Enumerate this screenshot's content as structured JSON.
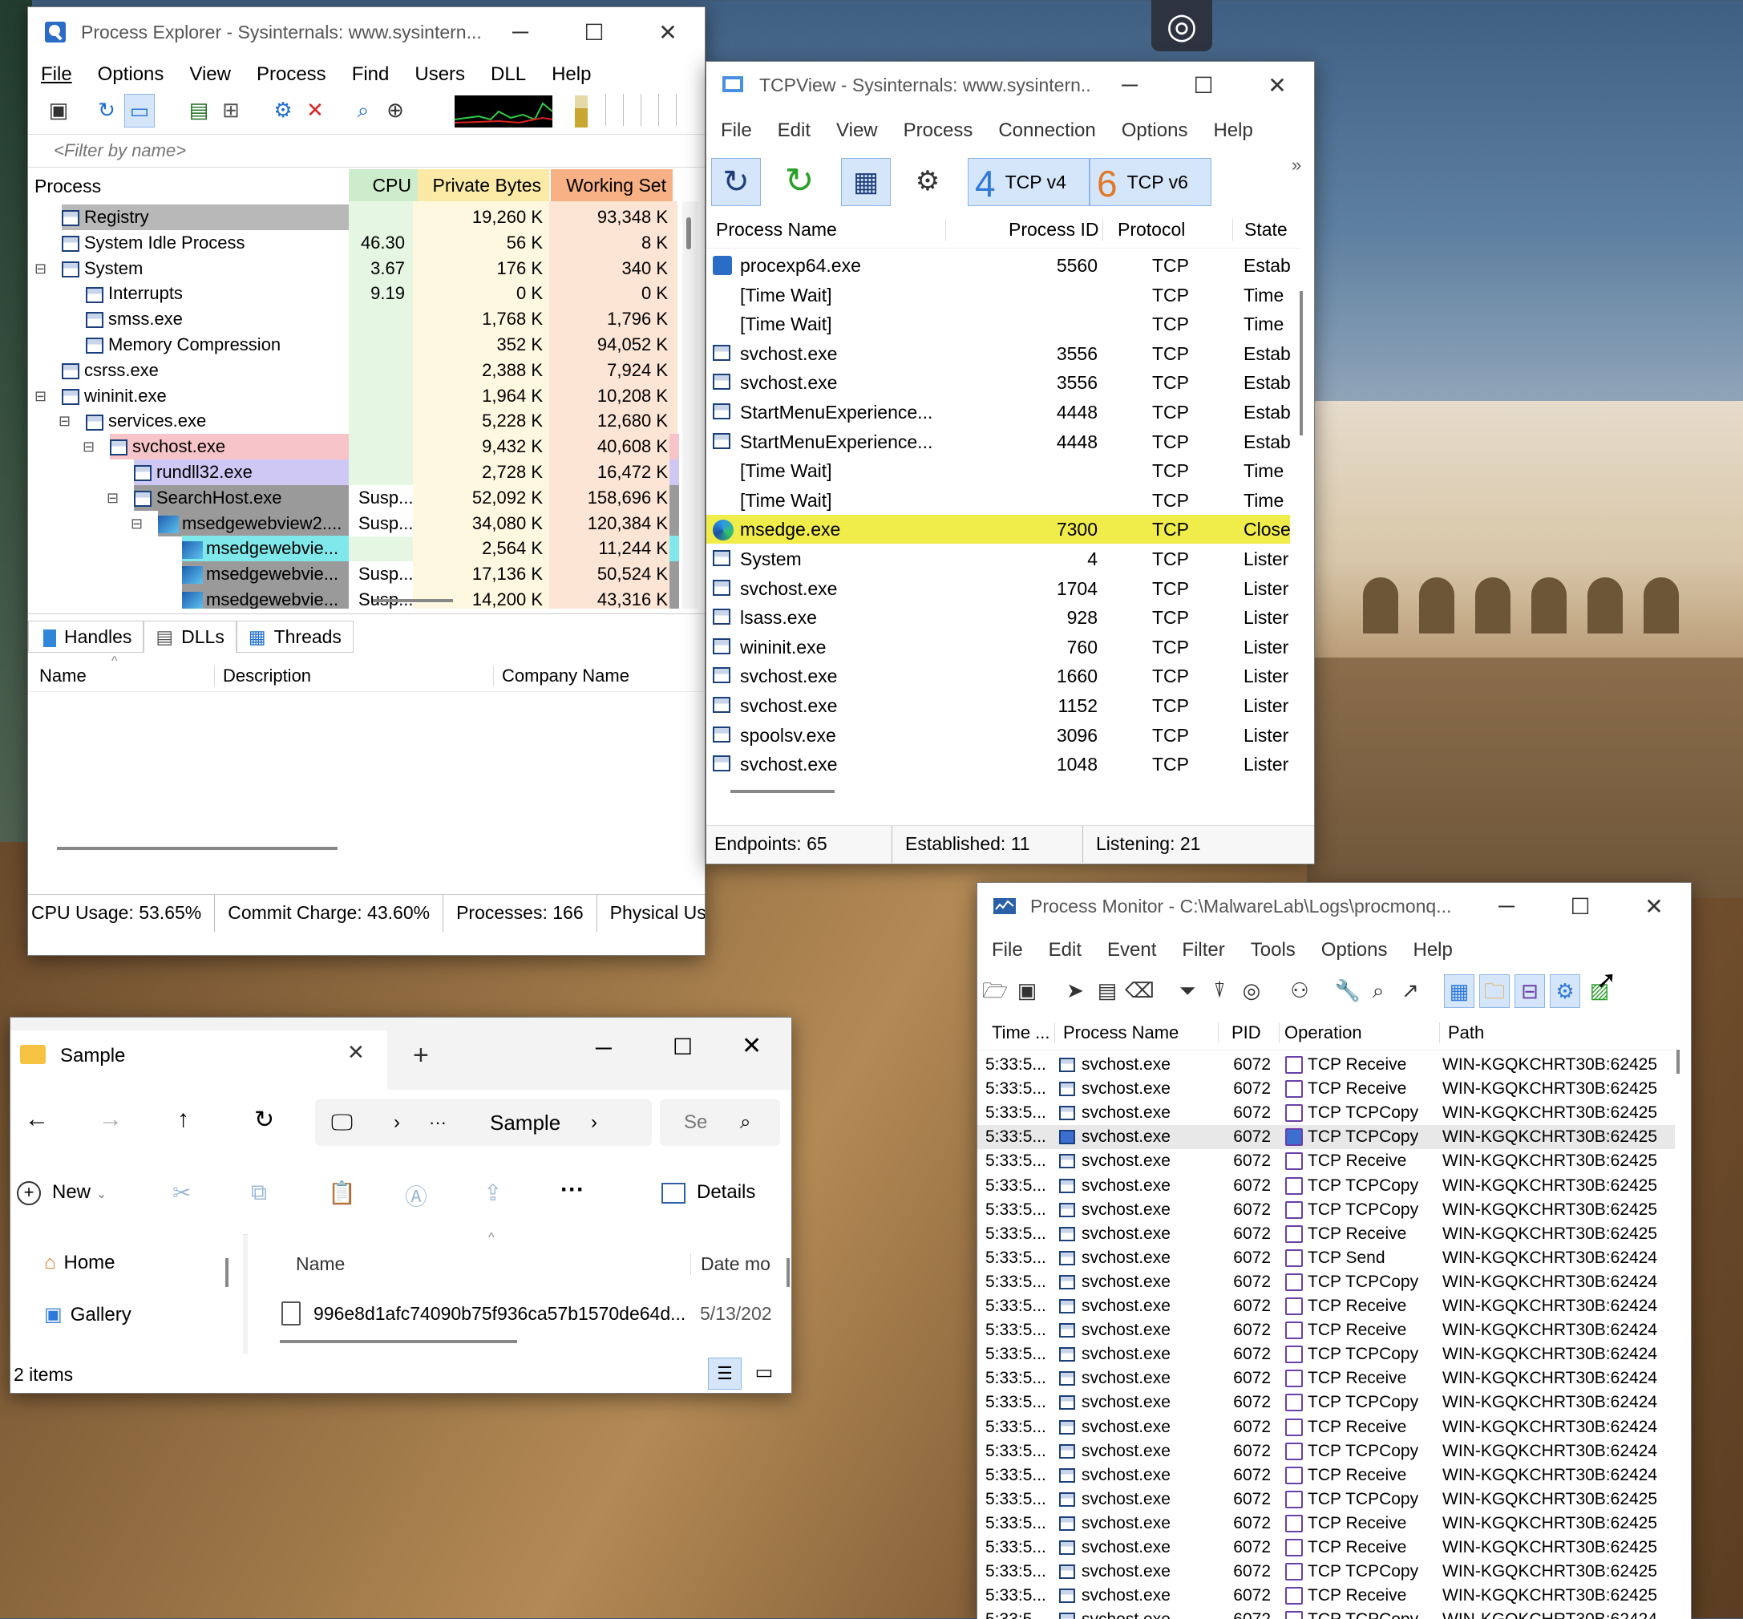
{
  "procexp": {
    "title": "Process Explorer - Sysinternals: www.sysintern...",
    "menu": [
      "File",
      "Options",
      "View",
      "Process",
      "Find",
      "Users",
      "DLL",
      "Help"
    ],
    "filter_placeholder": "<Filter by name>",
    "columns": {
      "process": "Process",
      "cpu": "CPU",
      "private": "Private Bytes",
      "working": "Working Set"
    },
    "rows": [
      {
        "name": "Registry",
        "cpu": "",
        "private": "19,260 K",
        "working": "93,348 K"
      },
      {
        "name": "System Idle Process",
        "cpu": "46.30",
        "private": "56 K",
        "working": "8 K"
      },
      {
        "name": "System",
        "cpu": "3.67",
        "private": "176 K",
        "working": "340 K"
      },
      {
        "name": "Interrupts",
        "cpu": "9.19",
        "private": "0 K",
        "working": "0 K"
      },
      {
        "name": "smss.exe",
        "cpu": "",
        "private": "1,768 K",
        "working": "1,796 K"
      },
      {
        "name": "Memory Compression",
        "cpu": "",
        "private": "352 K",
        "working": "94,052 K"
      },
      {
        "name": "csrss.exe",
        "cpu": "",
        "private": "2,388 K",
        "working": "7,924 K"
      },
      {
        "name": "wininit.exe",
        "cpu": "",
        "private": "1,964 K",
        "working": "10,208 K"
      },
      {
        "name": "services.exe",
        "cpu": "",
        "private": "5,228 K",
        "working": "12,680 K"
      },
      {
        "name": "svchost.exe",
        "cpu": "",
        "private": "9,432 K",
        "working": "40,608 K"
      },
      {
        "name": "rundll32.exe",
        "cpu": "",
        "private": "2,728 K",
        "working": "16,472 K"
      },
      {
        "name": "SearchHost.exe",
        "cpu": "Susp...",
        "private": "52,092 K",
        "working": "158,696 K"
      },
      {
        "name": "msedgewebview2....",
        "cpu": "Susp...",
        "private": "34,080 K",
        "working": "120,384 K"
      },
      {
        "name": "msedgewebvie...",
        "cpu": "",
        "private": "2,564 K",
        "working": "11,244 K"
      },
      {
        "name": "msedgewebvie...",
        "cpu": "Susp...",
        "private": "17,136 K",
        "working": "50,524 K"
      },
      {
        "name": "msedgewebvie...",
        "cpu": "Susp...",
        "private": "14,200 K",
        "working": "43,316 K"
      },
      {
        "name": "msedgewebvie...",
        "cpu": "",
        "private": "",
        "working": ""
      }
    ],
    "lower_tabs": [
      "Handles",
      "DLLs",
      "Threads"
    ],
    "lower_columns": {
      "name": "Name",
      "description": "Description",
      "company": "Company Name"
    },
    "status": [
      "CPU Usage: 53.65%",
      "Commit Charge: 43.60%",
      "Processes: 166",
      "Physical Usa"
    ]
  },
  "tcpview": {
    "title": "TCPView - Sysinternals: www.sysintern...",
    "menu": [
      "File",
      "Edit",
      "View",
      "Process",
      "Connection",
      "Options",
      "Help"
    ],
    "tcp4_label": "TCP v4",
    "tcp6_label": "TCP v6",
    "tcp4_num": "4",
    "tcp6_num": "6",
    "more": "»",
    "columns": {
      "name": "Process Name",
      "pid": "Process ID",
      "protocol": "Protocol",
      "state": "State"
    },
    "rows": [
      {
        "name": "procexp64.exe",
        "pid": "5560",
        "protocol": "TCP",
        "state": "Estab"
      },
      {
        "name": "[Time Wait]",
        "pid": "",
        "protocol": "TCP",
        "state": "Time"
      },
      {
        "name": "[Time Wait]",
        "pid": "",
        "protocol": "TCP",
        "state": "Time"
      },
      {
        "name": "svchost.exe",
        "pid": "3556",
        "protocol": "TCP",
        "state": "Estab"
      },
      {
        "name": "svchost.exe",
        "pid": "3556",
        "protocol": "TCP",
        "state": "Estab"
      },
      {
        "name": "StartMenuExperience...",
        "pid": "4448",
        "protocol": "TCP",
        "state": "Estab"
      },
      {
        "name": "StartMenuExperience...",
        "pid": "4448",
        "protocol": "TCP",
        "state": "Estab"
      },
      {
        "name": "[Time Wait]",
        "pid": "",
        "protocol": "TCP",
        "state": "Time"
      },
      {
        "name": "[Time Wait]",
        "pid": "",
        "protocol": "TCP",
        "state": "Time"
      },
      {
        "name": "msedge.exe",
        "pid": "7300",
        "protocol": "TCP",
        "state": "Close"
      },
      {
        "name": "System",
        "pid": "4",
        "protocol": "TCP",
        "state": "Lister"
      },
      {
        "name": "svchost.exe",
        "pid": "1704",
        "protocol": "TCP",
        "state": "Lister"
      },
      {
        "name": "lsass.exe",
        "pid": "928",
        "protocol": "TCP",
        "state": "Lister"
      },
      {
        "name": "wininit.exe",
        "pid": "760",
        "protocol": "TCP",
        "state": "Lister"
      },
      {
        "name": "svchost.exe",
        "pid": "1660",
        "protocol": "TCP",
        "state": "Lister"
      },
      {
        "name": "svchost.exe",
        "pid": "1152",
        "protocol": "TCP",
        "state": "Lister"
      },
      {
        "name": "spoolsv.exe",
        "pid": "3096",
        "protocol": "TCP",
        "state": "Lister"
      },
      {
        "name": "svchost.exe",
        "pid": "1048",
        "protocol": "TCP",
        "state": "Lister"
      }
    ],
    "status": [
      "Endpoints: 65",
      "Established: 11",
      "Listening: 21"
    ]
  },
  "procmon": {
    "title": "Process Monitor - C:\\MalwareLab\\Logs\\procmonq...",
    "menu": [
      "File",
      "Edit",
      "Event",
      "Filter",
      "Tools",
      "Options",
      "Help"
    ],
    "columns": {
      "time": "Time ...",
      "name": "Process Name",
      "pid": "PID",
      "op": "Operation",
      "path": "Path"
    },
    "rows": [
      {
        "time": "5:33:5...",
        "name": "svchost.exe",
        "pid": "6072",
        "op": "TCP Receive",
        "path": "WIN-KGQKCHRT30B:62425"
      },
      {
        "time": "5:33:5...",
        "name": "svchost.exe",
        "pid": "6072",
        "op": "TCP Receive",
        "path": "WIN-KGQKCHRT30B:62425"
      },
      {
        "time": "5:33:5...",
        "name": "svchost.exe",
        "pid": "6072",
        "op": "TCP TCPCopy",
        "path": "WIN-KGQKCHRT30B:62425"
      },
      {
        "time": "5:33:5...",
        "name": "svchost.exe",
        "pid": "6072",
        "op": "TCP TCPCopy",
        "path": "WIN-KGQKCHRT30B:62425"
      },
      {
        "time": "5:33:5...",
        "name": "svchost.exe",
        "pid": "6072",
        "op": "TCP Receive",
        "path": "WIN-KGQKCHRT30B:62425"
      },
      {
        "time": "5:33:5...",
        "name": "svchost.exe",
        "pid": "6072",
        "op": "TCP TCPCopy",
        "path": "WIN-KGQKCHRT30B:62425"
      },
      {
        "time": "5:33:5...",
        "name": "svchost.exe",
        "pid": "6072",
        "op": "TCP TCPCopy",
        "path": "WIN-KGQKCHRT30B:62425"
      },
      {
        "time": "5:33:5...",
        "name": "svchost.exe",
        "pid": "6072",
        "op": "TCP Receive",
        "path": "WIN-KGQKCHRT30B:62425"
      },
      {
        "time": "5:33:5...",
        "name": "svchost.exe",
        "pid": "6072",
        "op": "TCP Send",
        "path": "WIN-KGQKCHRT30B:62424"
      },
      {
        "time": "5:33:5...",
        "name": "svchost.exe",
        "pid": "6072",
        "op": "TCP TCPCopy",
        "path": "WIN-KGQKCHRT30B:62424"
      },
      {
        "time": "5:33:5...",
        "name": "svchost.exe",
        "pid": "6072",
        "op": "TCP Receive",
        "path": "WIN-KGQKCHRT30B:62424"
      },
      {
        "time": "5:33:5...",
        "name": "svchost.exe",
        "pid": "6072",
        "op": "TCP Receive",
        "path": "WIN-KGQKCHRT30B:62424"
      },
      {
        "time": "5:33:5...",
        "name": "svchost.exe",
        "pid": "6072",
        "op": "TCP TCPCopy",
        "path": "WIN-KGQKCHRT30B:62424"
      },
      {
        "time": "5:33:5...",
        "name": "svchost.exe",
        "pid": "6072",
        "op": "TCP Receive",
        "path": "WIN-KGQKCHRT30B:62424"
      },
      {
        "time": "5:33:5...",
        "name": "svchost.exe",
        "pid": "6072",
        "op": "TCP TCPCopy",
        "path": "WIN-KGQKCHRT30B:62424"
      },
      {
        "time": "5:33:5...",
        "name": "svchost.exe",
        "pid": "6072",
        "op": "TCP Receive",
        "path": "WIN-KGQKCHRT30B:62424"
      },
      {
        "time": "5:33:5...",
        "name": "svchost.exe",
        "pid": "6072",
        "op": "TCP TCPCopy",
        "path": "WIN-KGQKCHRT30B:62424"
      },
      {
        "time": "5:33:5...",
        "name": "svchost.exe",
        "pid": "6072",
        "op": "TCP Receive",
        "path": "WIN-KGQKCHRT30B:62424"
      },
      {
        "time": "5:33:5...",
        "name": "svchost.exe",
        "pid": "6072",
        "op": "TCP TCPCopy",
        "path": "WIN-KGQKCHRT30B:62425"
      },
      {
        "time": "5:33:5...",
        "name": "svchost.exe",
        "pid": "6072",
        "op": "TCP Receive",
        "path": "WIN-KGQKCHRT30B:62425"
      },
      {
        "time": "5:33:5...",
        "name": "svchost.exe",
        "pid": "6072",
        "op": "TCP Receive",
        "path": "WIN-KGQKCHRT30B:62425"
      },
      {
        "time": "5:33:5...",
        "name": "svchost.exe",
        "pid": "6072",
        "op": "TCP TCPCopy",
        "path": "WIN-KGQKCHRT30B:62425"
      },
      {
        "time": "5:33:5...",
        "name": "svchost.exe",
        "pid": "6072",
        "op": "TCP Receive",
        "path": "WIN-KGQKCHRT30B:62425"
      },
      {
        "time": "5:33:5...",
        "name": "svchost.exe",
        "pid": "6072",
        "op": "TCP TCPCopy",
        "path": "WIN-KGQKCHRT30B:62424"
      }
    ]
  },
  "explorer": {
    "tab_title": "Sample",
    "new_tab": "+",
    "breadcrumb_ellipsis": "···",
    "breadcrumb_current": "Sample",
    "search_placeholder": "Se",
    "new_label": "New",
    "more_label": "···",
    "details_label": "Details",
    "nav": [
      "Home",
      "Gallery"
    ],
    "columns": {
      "name": "Name",
      "date": "Date mo"
    },
    "files": [
      {
        "name": "996e8d1afc74090b75f936ca57b1570de64d...",
        "date": "5/13/202"
      }
    ],
    "status": "2 items"
  }
}
